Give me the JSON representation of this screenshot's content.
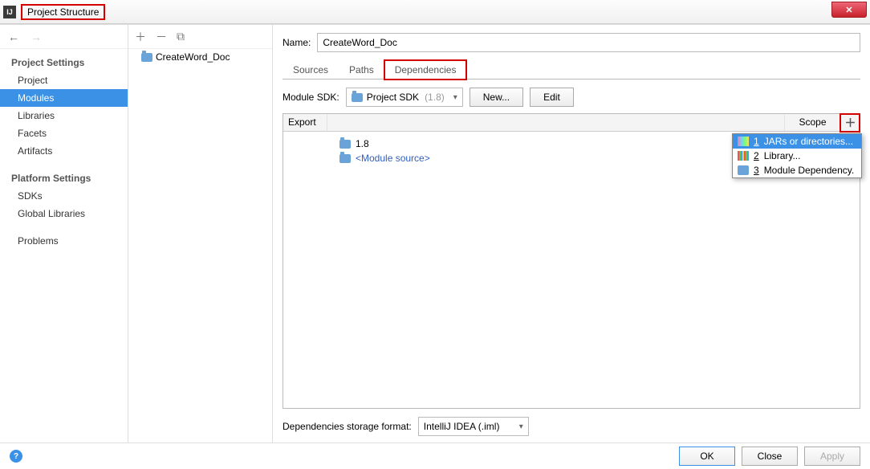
{
  "title": "Project Structure",
  "sidebar": {
    "group1_head": "Project Settings",
    "group1": [
      "Project",
      "Modules",
      "Libraries",
      "Facets",
      "Artifacts"
    ],
    "selected1": 1,
    "group2_head": "Platform Settings",
    "group2": [
      "SDKs",
      "Global Libraries"
    ],
    "group3": [
      "Problems"
    ]
  },
  "tree": {
    "module": "CreateWord_Doc"
  },
  "main": {
    "name_label": "Name:",
    "name_value": "CreateWord_Doc",
    "tabs": [
      "Sources",
      "Paths",
      "Dependencies"
    ],
    "active_tab": 2,
    "sdk_label": "Module SDK:",
    "sdk_value": "Project SDK",
    "sdk_version": "(1.8)",
    "new_btn": "New...",
    "edit_btn": "Edit",
    "header_export": "Export",
    "header_scope": "Scope",
    "dep_rows": [
      {
        "label": "1.8",
        "type": "sdk"
      },
      {
        "label": "<Module source>",
        "type": "mod"
      }
    ],
    "storage_label": "Dependencies storage format:",
    "storage_value": "IntelliJ IDEA (.iml)"
  },
  "popup": {
    "items": [
      {
        "n": "1",
        "label": "JARs or directories...",
        "icon": "jar"
      },
      {
        "n": "2",
        "label": "Library...",
        "icon": "lib"
      },
      {
        "n": "3",
        "label": "Module Dependency.",
        "icon": "folder"
      }
    ],
    "selected": 0
  },
  "footer": {
    "ok": "OK",
    "close": "Close",
    "apply": "Apply"
  }
}
